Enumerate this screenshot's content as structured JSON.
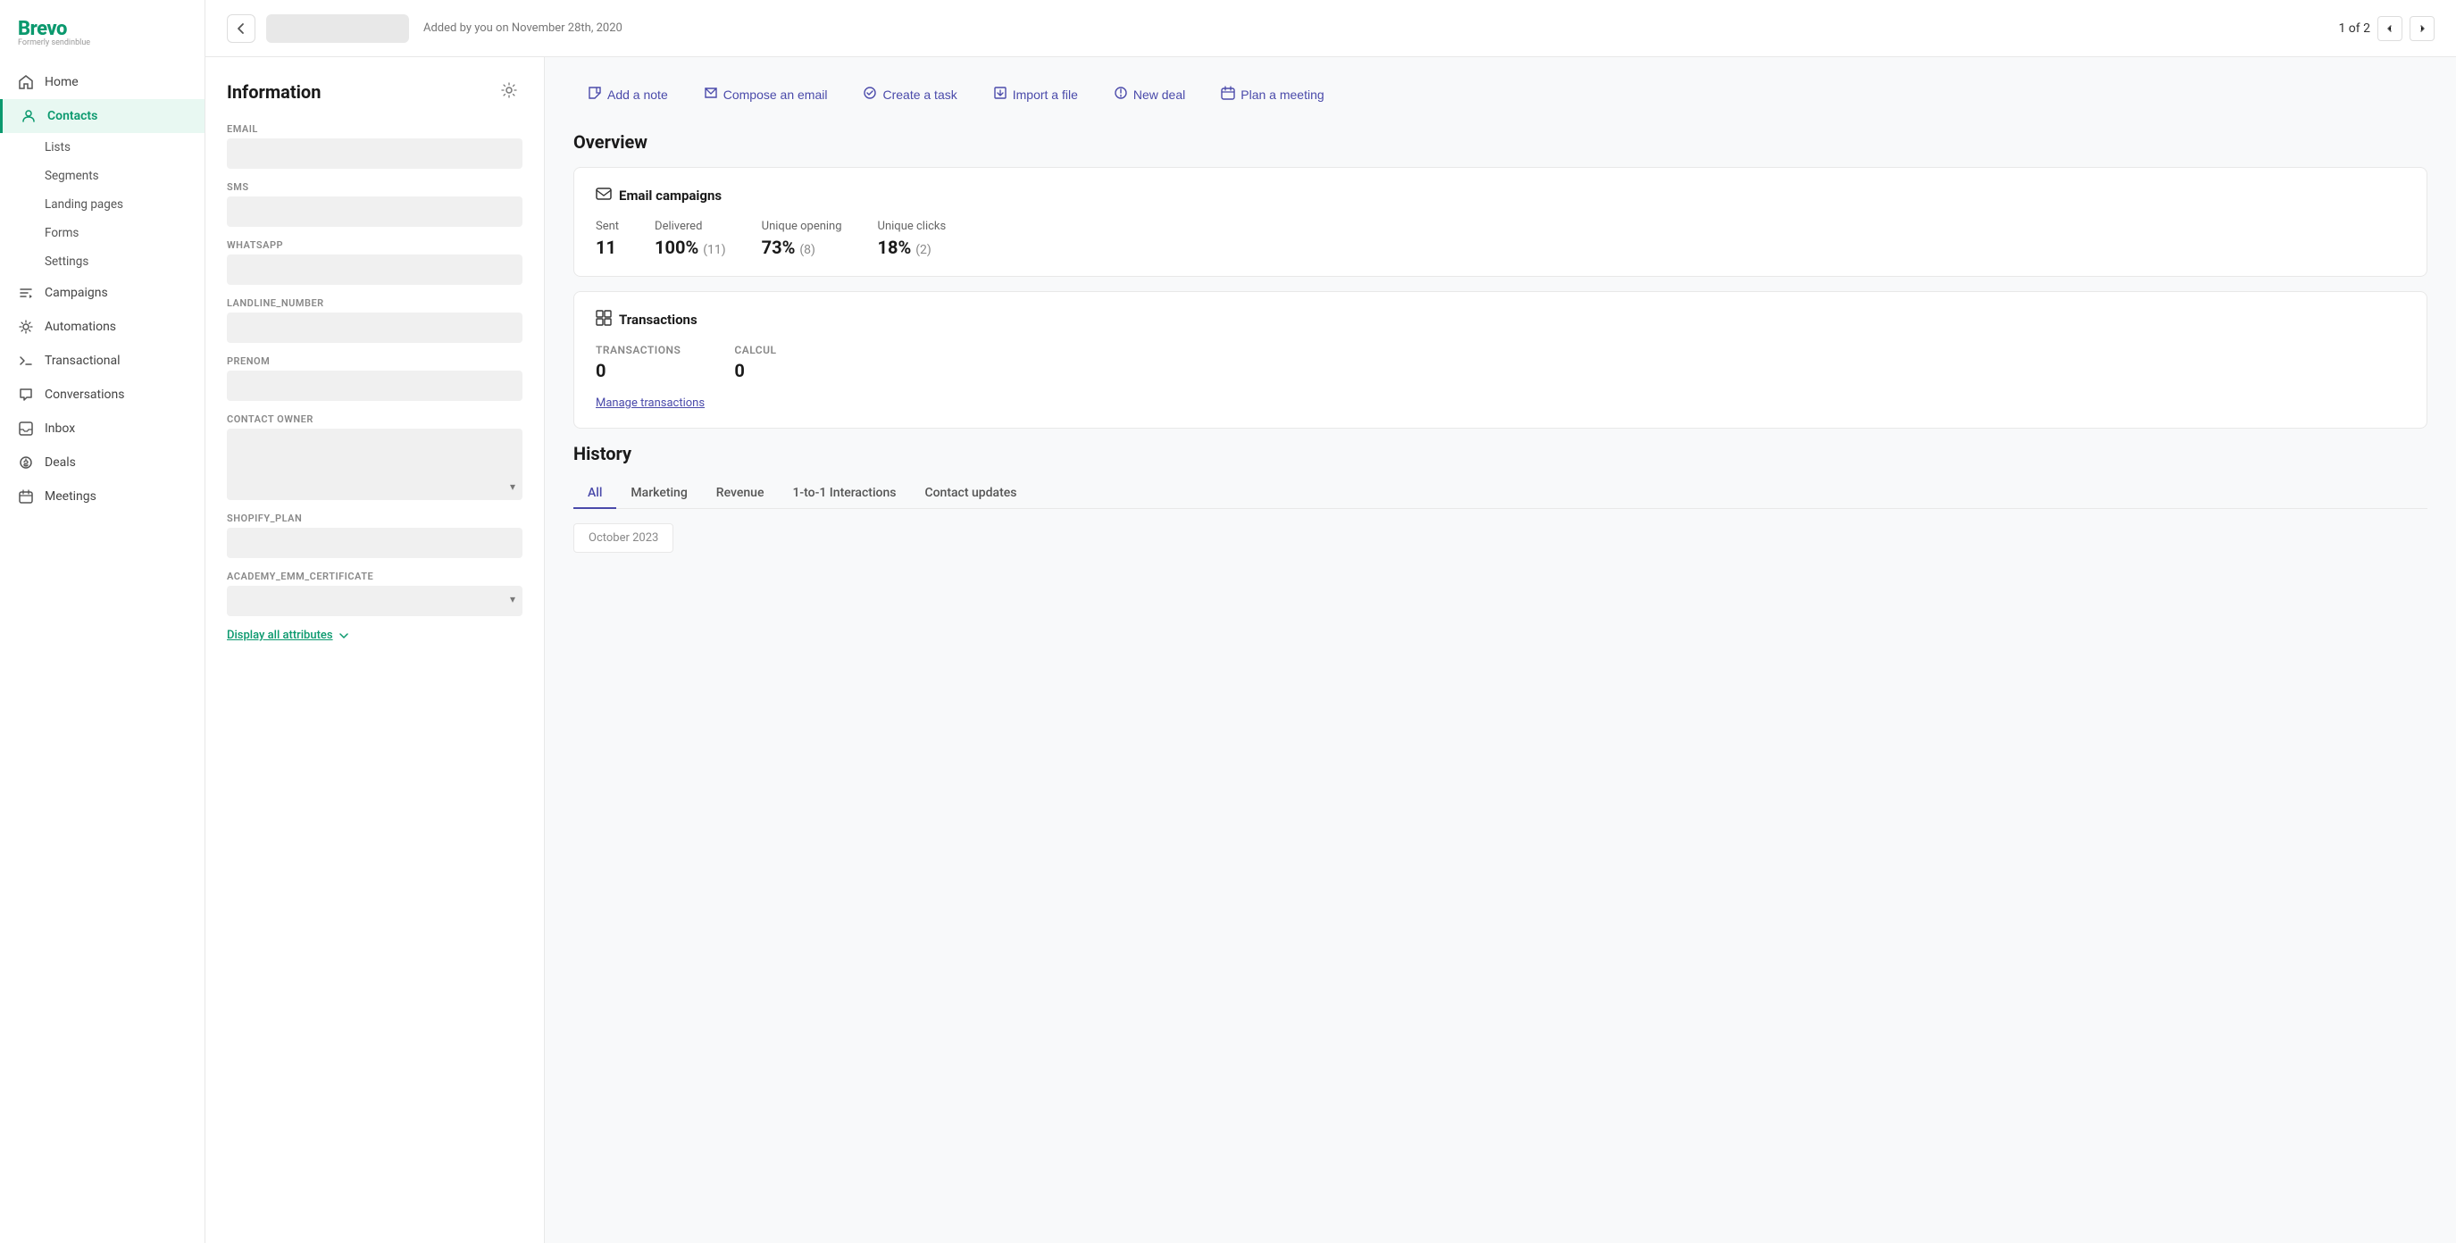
{
  "app": {
    "logo": "Brevo",
    "logo_sub": "Formerly sendinblue"
  },
  "sidebar": {
    "nav_items": [
      {
        "id": "home",
        "label": "Home",
        "icon": "home"
      },
      {
        "id": "contacts",
        "label": "Contacts",
        "icon": "contacts",
        "active": true
      },
      {
        "id": "campaigns",
        "label": "Campaigns",
        "icon": "campaigns"
      },
      {
        "id": "automations",
        "label": "Automations",
        "icon": "automations"
      },
      {
        "id": "transactional",
        "label": "Transactional",
        "icon": "transactional"
      },
      {
        "id": "conversations",
        "label": "Conversations",
        "icon": "conversations"
      },
      {
        "id": "inbox",
        "label": "Inbox",
        "icon": "inbox"
      },
      {
        "id": "deals",
        "label": "Deals",
        "icon": "deals"
      },
      {
        "id": "meetings",
        "label": "Meetings",
        "icon": "meetings"
      }
    ],
    "sub_items": [
      {
        "id": "lists",
        "label": "Lists"
      },
      {
        "id": "segments",
        "label": "Segments"
      },
      {
        "id": "landing-pages",
        "label": "Landing pages"
      },
      {
        "id": "forms",
        "label": "Forms"
      },
      {
        "id": "settings",
        "label": "Settings"
      }
    ]
  },
  "topbar": {
    "added_info": "Added by you on November 28th, 2020",
    "pagination": "1 of 2"
  },
  "info_panel": {
    "title": "Information",
    "fields": [
      {
        "id": "email",
        "label": "EMAIL"
      },
      {
        "id": "sms",
        "label": "SMS"
      },
      {
        "id": "whatsapp",
        "label": "WHATSAPP"
      },
      {
        "id": "landline",
        "label": "LANDLINE_NUMBER"
      },
      {
        "id": "prenom",
        "label": "PRENOM"
      },
      {
        "id": "contact_owner",
        "label": "CONTACT OWNER"
      },
      {
        "id": "shopify_plan",
        "label": "SHOPIFY_PLAN"
      },
      {
        "id": "academy",
        "label": "ACADEMY_EMM_CERTIFICATE"
      }
    ],
    "display_all": "Display all attributes"
  },
  "actions": {
    "add_note": "Add a note",
    "compose_email": "Compose an email",
    "create_task": "Create a task",
    "import_file": "Import a file",
    "new_deal": "New deal",
    "plan_meeting": "Plan a meeting"
  },
  "overview": {
    "title": "Overview",
    "email_campaigns": {
      "title": "Email campaigns",
      "stats": [
        {
          "label": "Sent",
          "value": "11",
          "sub": ""
        },
        {
          "label": "Delivered",
          "value": "100%",
          "sub": "(11)"
        },
        {
          "label": "Unique opening",
          "value": "73%",
          "sub": "(8)"
        },
        {
          "label": "Unique clicks",
          "value": "18%",
          "sub": "(2)"
        }
      ]
    },
    "transactions": {
      "title": "Transactions",
      "items": [
        {
          "label": "TRANSACTIONS",
          "value": "0"
        },
        {
          "label": "CALCUL",
          "value": "0"
        }
      ],
      "manage_link": "Manage transactions"
    }
  },
  "history": {
    "title": "History",
    "tabs": [
      {
        "id": "all",
        "label": "All",
        "active": true
      },
      {
        "id": "marketing",
        "label": "Marketing"
      },
      {
        "id": "revenue",
        "label": "Revenue"
      },
      {
        "id": "interactions",
        "label": "1-to-1 Interactions"
      },
      {
        "id": "contact_updates",
        "label": "Contact updates"
      }
    ],
    "date_header": "October 2023"
  }
}
